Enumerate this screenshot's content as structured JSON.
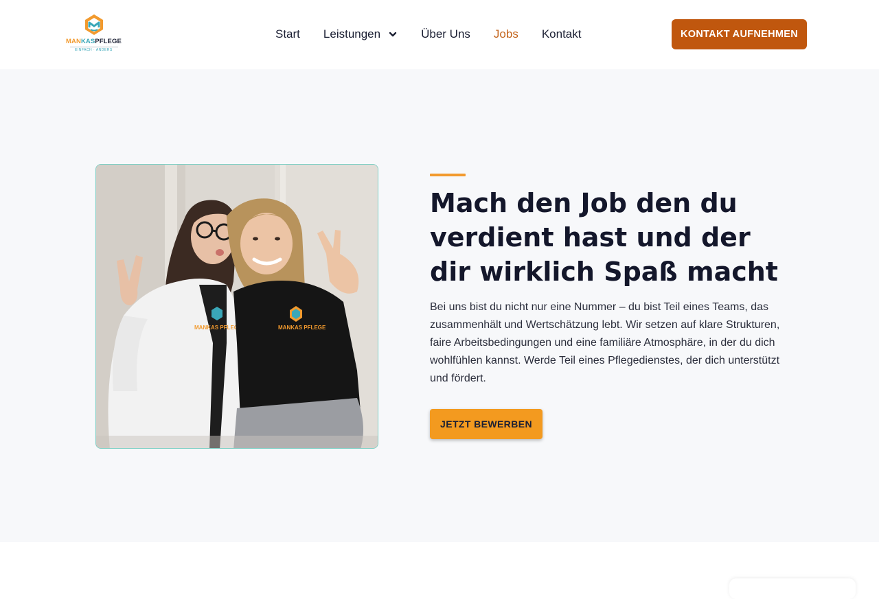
{
  "brand": {
    "logo_text_part1": "MAN",
    "logo_text_part2": "KAS",
    "logo_text_part3": "PFLEGE",
    "tagline": "EINFACH · ANDERS",
    "colors": {
      "orange": "#f29a2e",
      "teal": "#3aa7b8",
      "dark": "#1b1f33"
    }
  },
  "nav": {
    "items": [
      {
        "label": "Start",
        "active": false
      },
      {
        "label": "Leistungen",
        "active": false,
        "has_dropdown": true
      },
      {
        "label": "Über Uns",
        "active": false
      },
      {
        "label": "Jobs",
        "active": true
      },
      {
        "label": "Kontakt",
        "active": false
      }
    ],
    "cta_label": "KONTAKT AUFNEHMEN"
  },
  "hero": {
    "headline": "Mach den Job den du verdient hast und der dir wirklich Spaß macht",
    "body": "Bei uns bist du nicht nur eine Nummer – du bist Teil eines Teams, das zusammenhält und Wertschätzung lebt. Wir setzen auf klare Strukturen, faire Arbeitsbedingungen und eine familiäre Atmosphäre, in der du dich wohlfühlen kannst. Werde Teil eines Pflegedienstes, der dich unterstützt und fördert.",
    "cta_label": "JETZT BEWERBEN",
    "photo_shirt_text_1": "MANKAS PFLEGE",
    "photo_shirt_text_2": "MANKAS PFLEGE"
  },
  "icons": {
    "dropdown": "chevron-down-icon",
    "logo": "house-hands-logo-icon"
  }
}
